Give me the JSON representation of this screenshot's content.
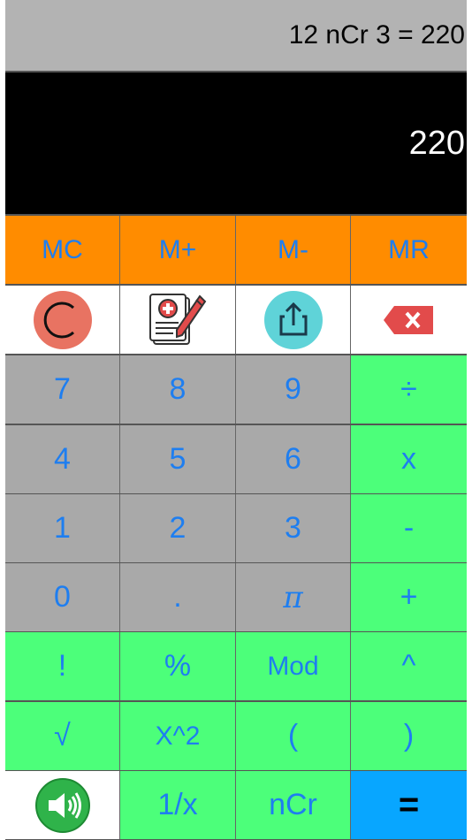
{
  "display": {
    "expression": "12 nCr 3 = 220",
    "result": "220"
  },
  "memory_row": [
    "MC",
    "M+",
    "M-",
    "MR"
  ],
  "tools_row": {
    "clear": {
      "icon": "clear-c-icon",
      "color": "#e87362"
    },
    "history": {
      "icon": "notes-document-icon"
    },
    "share": {
      "icon": "share-upload-icon",
      "color": "#5fd3d8"
    },
    "backspace": {
      "icon": "backspace-x-icon",
      "color": "#e24b4b"
    }
  },
  "keys": {
    "row1": [
      "7",
      "8",
      "9",
      "÷"
    ],
    "row2": [
      "4",
      "5",
      "6",
      "x"
    ],
    "row3": [
      "1",
      "2",
      "3",
      "-"
    ],
    "row4": [
      "0",
      ".",
      "π",
      "+"
    ],
    "row5": [
      "!",
      "%",
      "Mod",
      "^"
    ],
    "row6": [
      "√",
      "X^2",
      "(",
      ")"
    ],
    "row7": {
      "sound_icon": "speaker-sound-icon",
      "reciprocal": "1/x",
      "ncr": "nCr",
      "equals": "="
    }
  },
  "colors": {
    "memory_bg": "#ff8c00",
    "digit_bg": "#a9a9a9",
    "operator_bg": "#4cff7a",
    "equals_bg": "#08a6ff",
    "key_text": "#1e7ef0",
    "display_bg": "#000000",
    "expression_bg": "#b3b3b3"
  }
}
